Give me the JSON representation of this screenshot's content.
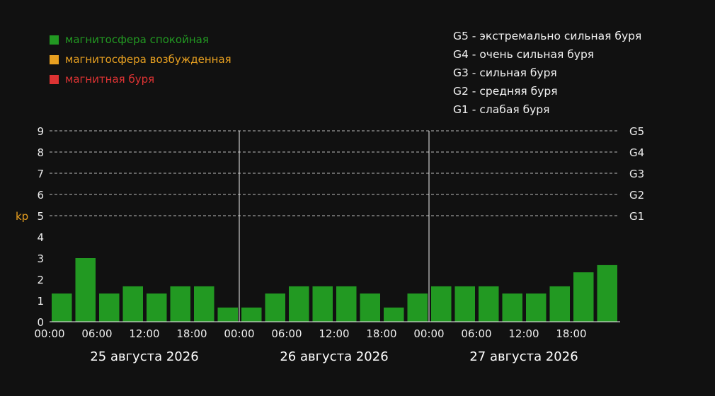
{
  "legend": {
    "items": [
      {
        "label": "магнитосфера спокойная",
        "color": "#229922"
      },
      {
        "label": "магнитосфера возбужденная",
        "color": "#e8a020"
      },
      {
        "label": "магнитная буря",
        "color": "#dd3333"
      }
    ]
  },
  "storm_scale": {
    "items": [
      {
        "code": "G5",
        "text": "экстремально сильная буря"
      },
      {
        "code": "G4",
        "text": "очень сильная буря"
      },
      {
        "code": "G3",
        "text": "сильная буря"
      },
      {
        "code": "G2",
        "text": "средняя буря"
      },
      {
        "code": "G1",
        "text": "слабая буря"
      }
    ]
  },
  "chart_data": {
    "type": "bar",
    "ylabel": "kp",
    "ylim": [
      0,
      9
    ],
    "yticks": [
      0,
      1,
      2,
      3,
      4,
      5,
      6,
      7,
      8,
      9
    ],
    "grid": "dashed horizontal at levels 5-9",
    "storm_levels": [
      {
        "label": "G1",
        "value": 5
      },
      {
        "label": "G2",
        "value": 6
      },
      {
        "label": "G3",
        "value": 7
      },
      {
        "label": "G4",
        "value": 8
      },
      {
        "label": "G5",
        "value": 9
      }
    ],
    "days": [
      "25 августа 2026",
      "26 августа 2026",
      "27 августа 2026"
    ],
    "time_ticks": [
      "00:00",
      "06:00",
      "12:00",
      "18:00"
    ],
    "bar_color": "#229922",
    "values": [
      1.33,
      3.0,
      1.33,
      1.67,
      1.33,
      1.67,
      1.67,
      0.67,
      0.67,
      1.33,
      1.67,
      1.67,
      1.67,
      1.33,
      0.67,
      1.33,
      1.67,
      1.67,
      1.67,
      1.33,
      1.33,
      1.67,
      2.33,
      2.67
    ]
  }
}
